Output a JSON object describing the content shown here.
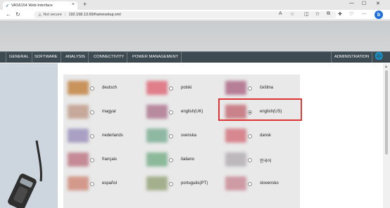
{
  "browser": {
    "tab_title": "VAS6154 Web-Interface",
    "security_label": "Not secure",
    "url": "192.168.13.69/framesetup.xml",
    "new_tab": "+",
    "profile_letter": "b"
  },
  "menu": {
    "items": [
      {
        "label": "GENERAL"
      },
      {
        "label": "SOFTWARE"
      },
      {
        "label": "ANALYSIS"
      },
      {
        "label": "CONNECTIVITY"
      },
      {
        "label": "POWER MANAGEMENT"
      }
    ],
    "admin_label": "ADMINISTRATION"
  },
  "languages": [
    {
      "label": "deutsch",
      "flag": "#c9935c",
      "selected": false
    },
    {
      "label": "polski",
      "flag": "#e07f8a",
      "selected": false
    },
    {
      "label": "čeština",
      "flag": "#b77f97",
      "selected": false
    },
    {
      "label": "magyar",
      "flag": "#c6a99a",
      "selected": false
    },
    {
      "label": "english(UK)",
      "flag": "#b88a9e",
      "selected": false
    },
    {
      "label": "english(US)",
      "flag": "#c98289",
      "selected": true
    },
    {
      "label": "nederlands",
      "flag": "#a9a0c3",
      "selected": false
    },
    {
      "label": "svenska",
      "flag": "#8fb8a3",
      "selected": false
    },
    {
      "label": "dansk",
      "flag": "#d7878f",
      "selected": false
    },
    {
      "label": "français",
      "flag": "#c58a95",
      "selected": false
    },
    {
      "label": "italiano",
      "flag": "#8cb99a",
      "selected": false
    },
    {
      "label": "한국어",
      "flag": "#bdb8bb",
      "selected": false
    },
    {
      "label": "español",
      "flag": "#d3998b",
      "selected": false
    },
    {
      "label": "português(PT)",
      "flag": "#a4b08d",
      "selected": false
    },
    {
      "label": "slovensko",
      "flag": "#ce9ba5",
      "selected": false
    }
  ]
}
